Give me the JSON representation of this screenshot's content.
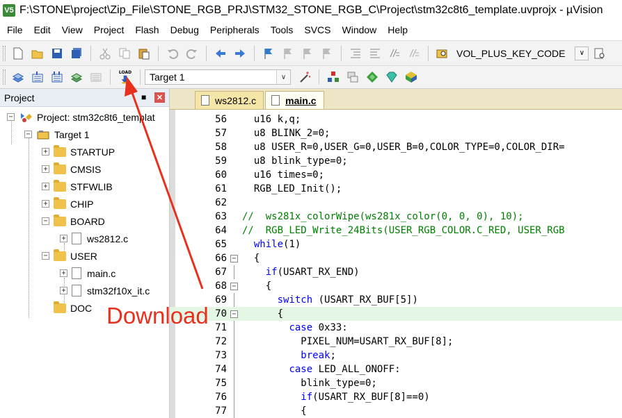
{
  "window": {
    "title": "F:\\STONE\\project\\Zip_File\\STONE_RGB_PRJ\\STM32_STONE_RGB_C\\Project\\stm32c8t6_template.uvprojx - µVision",
    "app_icon": "V5"
  },
  "menu": [
    "File",
    "Edit",
    "View",
    "Project",
    "Flash",
    "Debug",
    "Peripherals",
    "Tools",
    "SVCS",
    "Window",
    "Help"
  ],
  "toolbar": {
    "find_combo_value": "VOL_PLUS_KEY_CODE",
    "target_combo_value": "Target 1",
    "load_label": "LOAD"
  },
  "project_panel": {
    "title": "Project",
    "tree": {
      "root": "Project: stm32c8t6_templat",
      "target": "Target 1",
      "groups": [
        {
          "name": "STARTUP"
        },
        {
          "name": "CMSIS"
        },
        {
          "name": "STFWLIB"
        },
        {
          "name": "CHIP"
        },
        {
          "name": "BOARD",
          "files": [
            "ws2812.c"
          ]
        },
        {
          "name": "USER",
          "files": [
            "main.c",
            "stm32f10x_it.c"
          ]
        },
        {
          "name": "DOC"
        }
      ]
    }
  },
  "editor": {
    "tabs": [
      {
        "label": "ws2812.c",
        "active": false
      },
      {
        "label": "main.c",
        "active": true
      }
    ],
    "lines": [
      {
        "n": "56",
        "text": "  u16 k,q;"
      },
      {
        "n": "57",
        "text": "  u8 BLINK_2=0;"
      },
      {
        "n": "58",
        "text": "  u8 USER_R=0,USER_G=0,USER_B=0,COLOR_TYPE=0,COLOR_DIR="
      },
      {
        "n": "59",
        "text": "  u8 blink_type=0;"
      },
      {
        "n": "60",
        "text": "  u16 times=0;"
      },
      {
        "n": "61",
        "text": "  RGB_LED_Init();"
      },
      {
        "n": "62",
        "text": ""
      },
      {
        "n": "63",
        "text": "//  ws281x_colorWipe(ws281x_color(0, 0, 0), 10);"
      },
      {
        "n": "64",
        "text": "//  RGB_LED_Write_24Bits(USER_RGB_COLOR.C_RED, USER_RGB"
      },
      {
        "n": "65",
        "text": "  while(1)"
      },
      {
        "n": "66",
        "text": "  {"
      },
      {
        "n": "67",
        "text": "    if(USART_RX_END)"
      },
      {
        "n": "68",
        "text": "    {"
      },
      {
        "n": "69",
        "text": "      switch (USART_RX_BUF[5])"
      },
      {
        "n": "70",
        "text": "      {"
      },
      {
        "n": "71",
        "text": "        case 0x33:"
      },
      {
        "n": "72",
        "text": "          PIXEL_NUM=USART_RX_BUF[8];"
      },
      {
        "n": "73",
        "text": "          break;"
      },
      {
        "n": "74",
        "text": "        case LED_ALL_ONOFF:"
      },
      {
        "n": "75",
        "text": "          blink_type=0;"
      },
      {
        "n": "76",
        "text": "          if(USART_RX_BUF[8]==0)"
      },
      {
        "n": "77",
        "text": "          {"
      }
    ]
  },
  "annotation": {
    "label": "Download",
    "color": "#e8301f"
  }
}
